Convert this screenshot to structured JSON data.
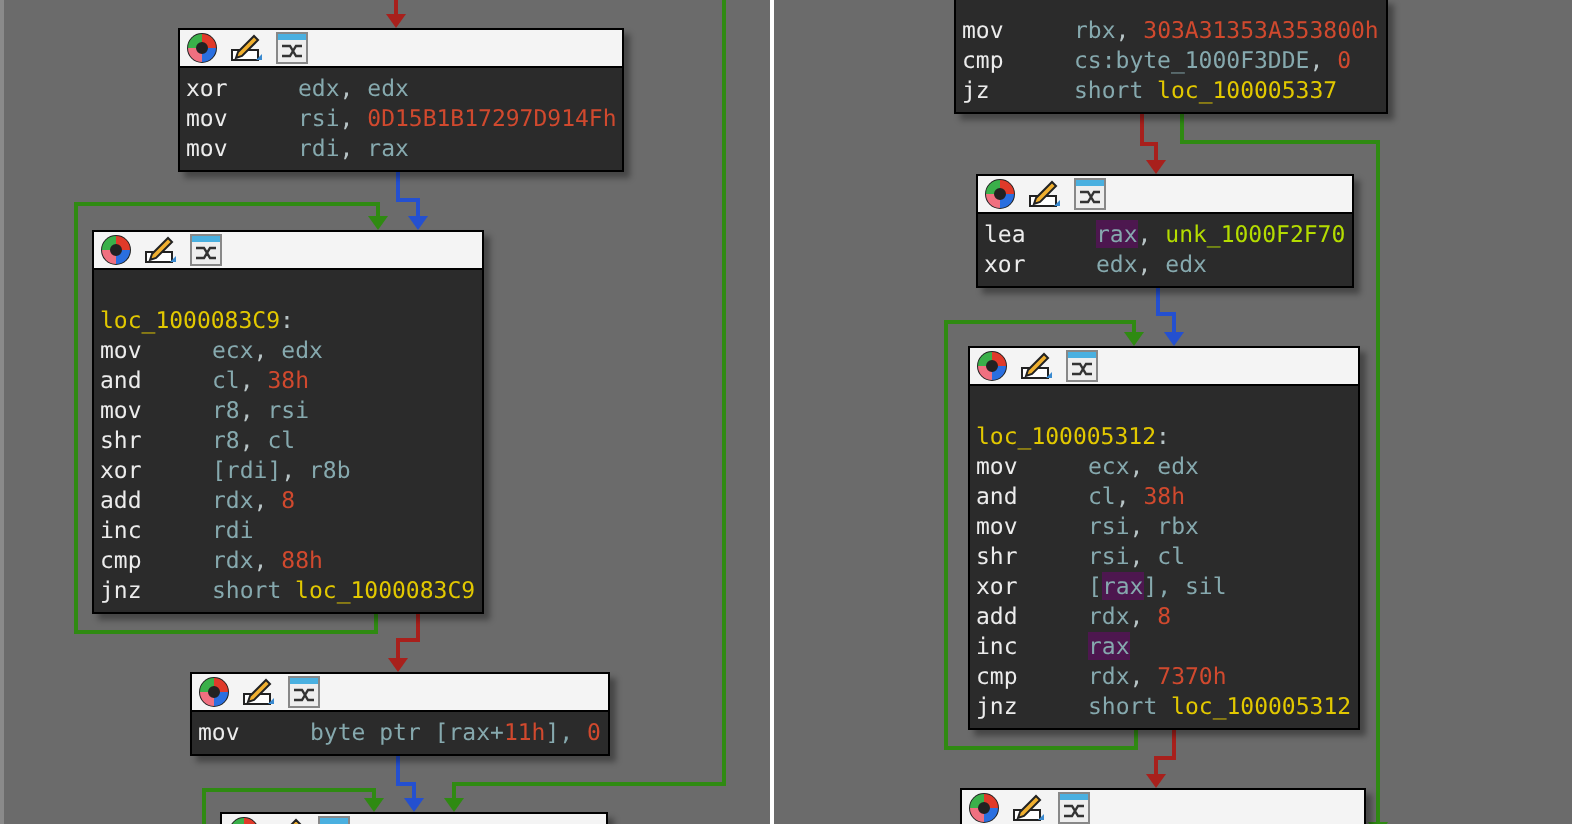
{
  "panels": [
    {
      "nodes": [
        {
          "header": true,
          "lines": [
            {
              "kind": "instr",
              "mnemonic": "xor",
              "operands": [
                {
                  "text": "edx",
                  "kind": "reg"
                },
                {
                  "text": ", ",
                  "kind": "punct"
                },
                {
                  "text": "edx",
                  "kind": "reg"
                }
              ]
            },
            {
              "kind": "instr",
              "mnemonic": "mov",
              "operands": [
                {
                  "text": "rsi",
                  "kind": "reg"
                },
                {
                  "text": ", ",
                  "kind": "punct"
                },
                {
                  "text": "0D15B1B17297D914Fh",
                  "kind": "num"
                }
              ]
            },
            {
              "kind": "instr",
              "mnemonic": "mov",
              "operands": [
                {
                  "text": "rdi",
                  "kind": "reg"
                },
                {
                  "text": ", ",
                  "kind": "punct"
                },
                {
                  "text": "rax",
                  "kind": "reg"
                }
              ]
            }
          ]
        },
        {
          "header": true,
          "lines": [
            {
              "kind": "blank"
            },
            {
              "kind": "label",
              "operands": [
                {
                  "text": "loc_1000083C9",
                  "kind": "label"
                },
                {
                  "text": ":",
                  "kind": "punct"
                }
              ]
            },
            {
              "kind": "instr",
              "mnemonic": "mov",
              "operands": [
                {
                  "text": "ecx",
                  "kind": "reg"
                },
                {
                  "text": ", ",
                  "kind": "punct"
                },
                {
                  "text": "edx",
                  "kind": "reg"
                }
              ]
            },
            {
              "kind": "instr",
              "mnemonic": "and",
              "operands": [
                {
                  "text": "cl",
                  "kind": "reg"
                },
                {
                  "text": ", ",
                  "kind": "punct"
                },
                {
                  "text": "38h",
                  "kind": "num"
                }
              ]
            },
            {
              "kind": "instr",
              "mnemonic": "mov",
              "operands": [
                {
                  "text": "r8",
                  "kind": "reg"
                },
                {
                  "text": ", ",
                  "kind": "punct"
                },
                {
                  "text": "rsi",
                  "kind": "reg"
                }
              ]
            },
            {
              "kind": "instr",
              "mnemonic": "shr",
              "operands": [
                {
                  "text": "r8",
                  "kind": "reg"
                },
                {
                  "text": ", ",
                  "kind": "punct"
                },
                {
                  "text": "cl",
                  "kind": "reg"
                }
              ]
            },
            {
              "kind": "instr",
              "mnemonic": "xor",
              "operands": [
                {
                  "text": "[rdi]",
                  "kind": "reg"
                },
                {
                  "text": ", ",
                  "kind": "punct"
                },
                {
                  "text": "r8b",
                  "kind": "reg"
                }
              ]
            },
            {
              "kind": "instr",
              "mnemonic": "add",
              "operands": [
                {
                  "text": "rdx",
                  "kind": "reg"
                },
                {
                  "text": ", ",
                  "kind": "punct"
                },
                {
                  "text": "8",
                  "kind": "num"
                }
              ]
            },
            {
              "kind": "instr",
              "mnemonic": "inc",
              "operands": [
                {
                  "text": "rdi",
                  "kind": "reg"
                }
              ]
            },
            {
              "kind": "instr",
              "mnemonic": "cmp",
              "operands": [
                {
                  "text": "rdx",
                  "kind": "reg"
                },
                {
                  "text": ", ",
                  "kind": "punct"
                },
                {
                  "text": "88h",
                  "kind": "num"
                }
              ]
            },
            {
              "kind": "instr",
              "mnemonic": "jnz",
              "operands": [
                {
                  "text": "short ",
                  "kind": "reg"
                },
                {
                  "text": "loc_1000083C9",
                  "kind": "label"
                }
              ]
            }
          ]
        },
        {
          "header": true,
          "lines": [
            {
              "kind": "instr",
              "mnemonic": "mov",
              "operands": [
                {
                  "text": "byte ptr [rax+",
                  "kind": "reg"
                },
                {
                  "text": "11h",
                  "kind": "num"
                },
                {
                  "text": "], ",
                  "kind": "reg"
                },
                {
                  "text": "0",
                  "kind": "num"
                }
              ]
            }
          ]
        },
        {
          "header": true
        }
      ]
    },
    {
      "nodes": [
        {
          "header": false,
          "lines": [
            {
              "kind": "instr",
              "mnemonic": "mov",
              "operands": [
                {
                  "text": "rbx",
                  "kind": "reg"
                },
                {
                  "text": ", ",
                  "kind": "punct"
                },
                {
                  "text": "303A31353A353800h",
                  "kind": "num"
                }
              ]
            },
            {
              "kind": "instr",
              "mnemonic": "cmp",
              "operands": [
                {
                  "text": "cs:byte_1000F3DDE",
                  "kind": "reg"
                },
                {
                  "text": ", ",
                  "kind": "punct"
                },
                {
                  "text": "0",
                  "kind": "num"
                }
              ]
            },
            {
              "kind": "instr",
              "mnemonic": "jz",
              "operands": [
                {
                  "text": "short ",
                  "kind": "reg"
                },
                {
                  "text": "loc_100005337",
                  "kind": "label"
                }
              ]
            }
          ]
        },
        {
          "header": true,
          "lines": [
            {
              "kind": "instr",
              "mnemonic": "lea",
              "operands": [
                {
                  "text": "rax",
                  "kind": "hl"
                },
                {
                  "text": ", ",
                  "kind": "punct"
                },
                {
                  "text": "unk_1000F2F70",
                  "kind": "name"
                }
              ]
            },
            {
              "kind": "instr",
              "mnemonic": "xor",
              "operands": [
                {
                  "text": "edx",
                  "kind": "reg"
                },
                {
                  "text": ", ",
                  "kind": "punct"
                },
                {
                  "text": "edx",
                  "kind": "reg"
                }
              ]
            }
          ]
        },
        {
          "header": true,
          "lines": [
            {
              "kind": "blank"
            },
            {
              "kind": "label",
              "operands": [
                {
                  "text": "loc_100005312",
                  "kind": "label"
                },
                {
                  "text": ":",
                  "kind": "punct"
                }
              ]
            },
            {
              "kind": "instr",
              "mnemonic": "mov",
              "operands": [
                {
                  "text": "ecx",
                  "kind": "reg"
                },
                {
                  "text": ", ",
                  "kind": "punct"
                },
                {
                  "text": "edx",
                  "kind": "reg"
                }
              ]
            },
            {
              "kind": "instr",
              "mnemonic": "and",
              "operands": [
                {
                  "text": "cl",
                  "kind": "reg"
                },
                {
                  "text": ", ",
                  "kind": "punct"
                },
                {
                  "text": "38h",
                  "kind": "num"
                }
              ]
            },
            {
              "kind": "instr",
              "mnemonic": "mov",
              "operands": [
                {
                  "text": "rsi",
                  "kind": "reg"
                },
                {
                  "text": ", ",
                  "kind": "punct"
                },
                {
                  "text": "rbx",
                  "kind": "reg"
                }
              ]
            },
            {
              "kind": "instr",
              "mnemonic": "shr",
              "operands": [
                {
                  "text": "rsi",
                  "kind": "reg"
                },
                {
                  "text": ", ",
                  "kind": "punct"
                },
                {
                  "text": "cl",
                  "kind": "reg"
                }
              ]
            },
            {
              "kind": "instr",
              "mnemonic": "xor",
              "operands": [
                {
                  "text": "[",
                  "kind": "reg"
                },
                {
                  "text": "rax",
                  "kind": "hl"
                },
                {
                  "text": "], sil",
                  "kind": "reg"
                }
              ]
            },
            {
              "kind": "instr",
              "mnemonic": "add",
              "operands": [
                {
                  "text": "rdx",
                  "kind": "reg"
                },
                {
                  "text": ", ",
                  "kind": "punct"
                },
                {
                  "text": "8",
                  "kind": "num"
                }
              ]
            },
            {
              "kind": "instr",
              "mnemonic": "inc",
              "operands": [
                {
                  "text": "rax",
                  "kind": "hl"
                }
              ]
            },
            {
              "kind": "instr",
              "mnemonic": "cmp",
              "operands": [
                {
                  "text": "rdx",
                  "kind": "reg"
                },
                {
                  "text": ", ",
                  "kind": "punct"
                },
                {
                  "text": "7370h",
                  "kind": "num"
                }
              ]
            },
            {
              "kind": "instr",
              "mnemonic": "jnz",
              "operands": [
                {
                  "text": "short ",
                  "kind": "reg"
                },
                {
                  "text": "loc_100005312",
                  "kind": "label"
                }
              ]
            }
          ]
        },
        {
          "header": true
        }
      ]
    }
  ]
}
